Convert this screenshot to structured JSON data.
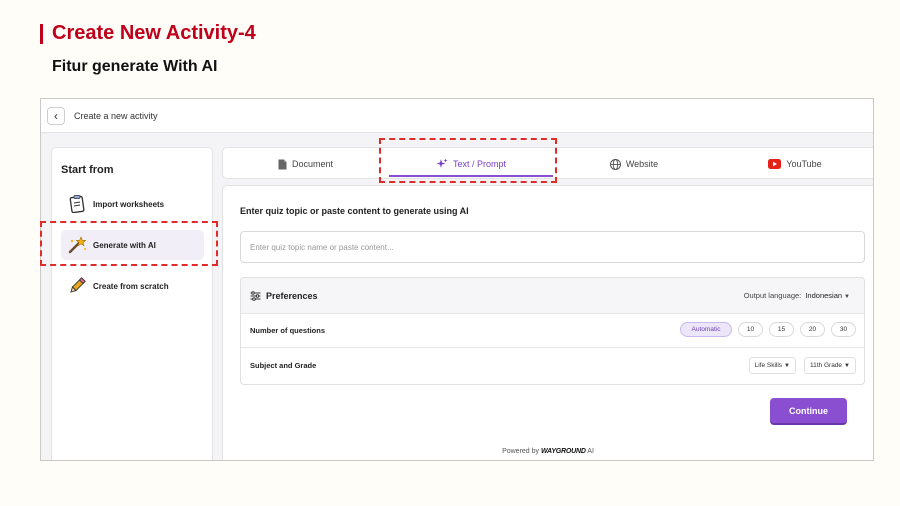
{
  "slide": {
    "title": "Create New Activity-4",
    "subtitle": "Fitur generate With AI"
  },
  "topbar": {
    "title": "Create a new activity"
  },
  "sidebar": {
    "title": "Start from",
    "items": [
      {
        "label": "Import worksheets",
        "icon": "clipboard-icon"
      },
      {
        "label": "Generate with AI",
        "icon": "magic-wand-icon",
        "active": true
      },
      {
        "label": "Create from scratch",
        "icon": "pencil-icon"
      }
    ]
  },
  "tabs": [
    {
      "label": "Document",
      "icon": "document-icon"
    },
    {
      "label": "Text / Prompt",
      "icon": "sparkle-icon",
      "active": true
    },
    {
      "label": "Website",
      "icon": "globe-icon"
    },
    {
      "label": "YouTube",
      "icon": "youtube-icon"
    }
  ],
  "prompt": {
    "label": "Enter quiz topic or paste content to generate using AI",
    "placeholder": "Enter quiz topic name or paste content..."
  },
  "preferences": {
    "title": "Preferences",
    "language_label": "Output language:",
    "language_value": "Indonesian",
    "num_questions_label": "Number of questions",
    "num_options": [
      "Automatic",
      "10",
      "15",
      "20",
      "30"
    ],
    "subject_label": "Subject and Grade",
    "subject_value": "Life Skills",
    "grade_value": "11th Grade"
  },
  "actions": {
    "continue_label": "Continue"
  },
  "footer": {
    "powered_by": "Powered by",
    "brand": "WAYGROUND",
    "brand_suffix": "AI"
  },
  "colors": {
    "slide_accent": "#c0001a",
    "primary": "#8a4fd0",
    "highlight_dash": "#e02b2b"
  }
}
